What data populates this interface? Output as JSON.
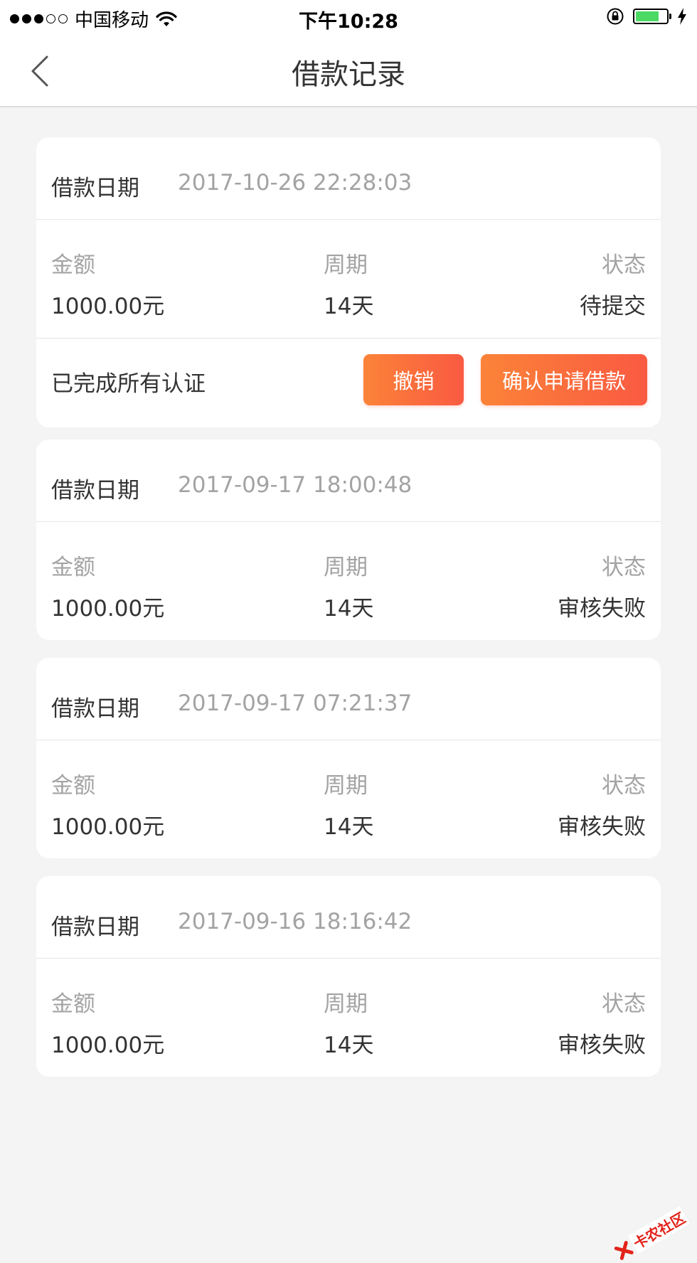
{
  "status_bar": {
    "carrier": "中国移动",
    "time": "下午10:28",
    "battery_level": 0.75,
    "battery_color": "#4cd964"
  },
  "nav": {
    "title": "借款记录",
    "back_icon": "chevron-left-icon"
  },
  "labels": {
    "date": "借款日期",
    "amount": "金额",
    "period": "周期",
    "status": "状态"
  },
  "records": [
    {
      "date": "2017-10-26 22:28:03",
      "amount": "1000.00元",
      "period": "14天",
      "status": "待提交",
      "footer_text": "已完成所有认证",
      "cancel_label": "撤销",
      "confirm_label": "确认申请借款"
    },
    {
      "date": "2017-09-17 18:00:48",
      "amount": "1000.00元",
      "period": "14天",
      "status": "审核失败"
    },
    {
      "date": "2017-09-17 07:21:37",
      "amount": "1000.00元",
      "period": "14天",
      "status": "审核失败"
    },
    {
      "date": "2017-09-16 18:16:42",
      "amount": "1000.00元",
      "period": "14天",
      "status": "审核失败"
    }
  ],
  "watermark": {
    "text": "卡农社区"
  },
  "colors": {
    "accent_start": "#fb8338",
    "accent_end": "#fa5a42",
    "background": "#f4f4f4",
    "muted_text": "#a3a3a3"
  }
}
